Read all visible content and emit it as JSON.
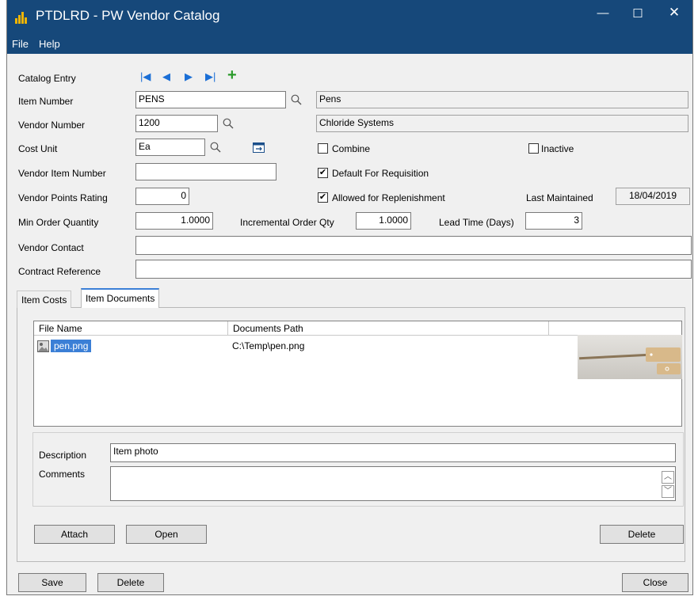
{
  "window": {
    "title": "PTDLRD - PW Vendor Catalog",
    "minimize": "—",
    "maximize": "☐",
    "close": "✕"
  },
  "menu": {
    "file": "File",
    "help": "Help"
  },
  "form": {
    "catalog_entry_label": "Catalog Entry",
    "item_number_label": "Item Number",
    "item_number": "PENS",
    "item_desc": "Pens",
    "vendor_number_label": "Vendor Number",
    "vendor_number": "1200",
    "vendor_name": "Chloride Systems",
    "cost_unit_label": "Cost Unit",
    "cost_unit": "Ea",
    "combine_label": "Combine",
    "combine_checked": false,
    "inactive_label": "Inactive",
    "inactive_checked": false,
    "vendor_item_number_label": "Vendor Item Number",
    "vendor_item_number": "",
    "default_req_label": "Default For Requisition",
    "default_req_checked": true,
    "vendor_points_label": "Vendor Points Rating",
    "vendor_points": "0",
    "allowed_replen_label": "Allowed for Replenishment",
    "allowed_replen_checked": true,
    "last_maintained_label": "Last Maintained",
    "last_maintained": "18/04/2019",
    "min_order_label": "Min Order Quantity",
    "min_order": "1.0000",
    "incr_order_label": "Incremental Order Qty",
    "incr_order": "1.0000",
    "lead_time_label": "Lead Time (Days)",
    "lead_time": "3",
    "vendor_contact_label": "Vendor Contact",
    "vendor_contact": "",
    "contract_ref_label": "Contract Reference",
    "contract_ref": ""
  },
  "tabs": {
    "item_costs": "Item Costs",
    "item_documents": "Item Documents"
  },
  "grid": {
    "col_file": "File Name",
    "col_path": "Documents Path",
    "rows": [
      {
        "file": "pen.png",
        "path": "C:\\Temp\\pen.png"
      }
    ]
  },
  "details": {
    "description_label": "Description",
    "description": "Item photo",
    "comments_label": "Comments",
    "comments": ""
  },
  "buttons": {
    "attach": "Attach",
    "open": "Open",
    "delete_doc": "Delete",
    "save": "Save",
    "delete": "Delete",
    "close": "Close"
  },
  "colors": {
    "titlebar": "#16487a",
    "nav_arrows": "#1b6fd6",
    "add": "#2a9a2a",
    "selection": "#3b7fd6"
  }
}
